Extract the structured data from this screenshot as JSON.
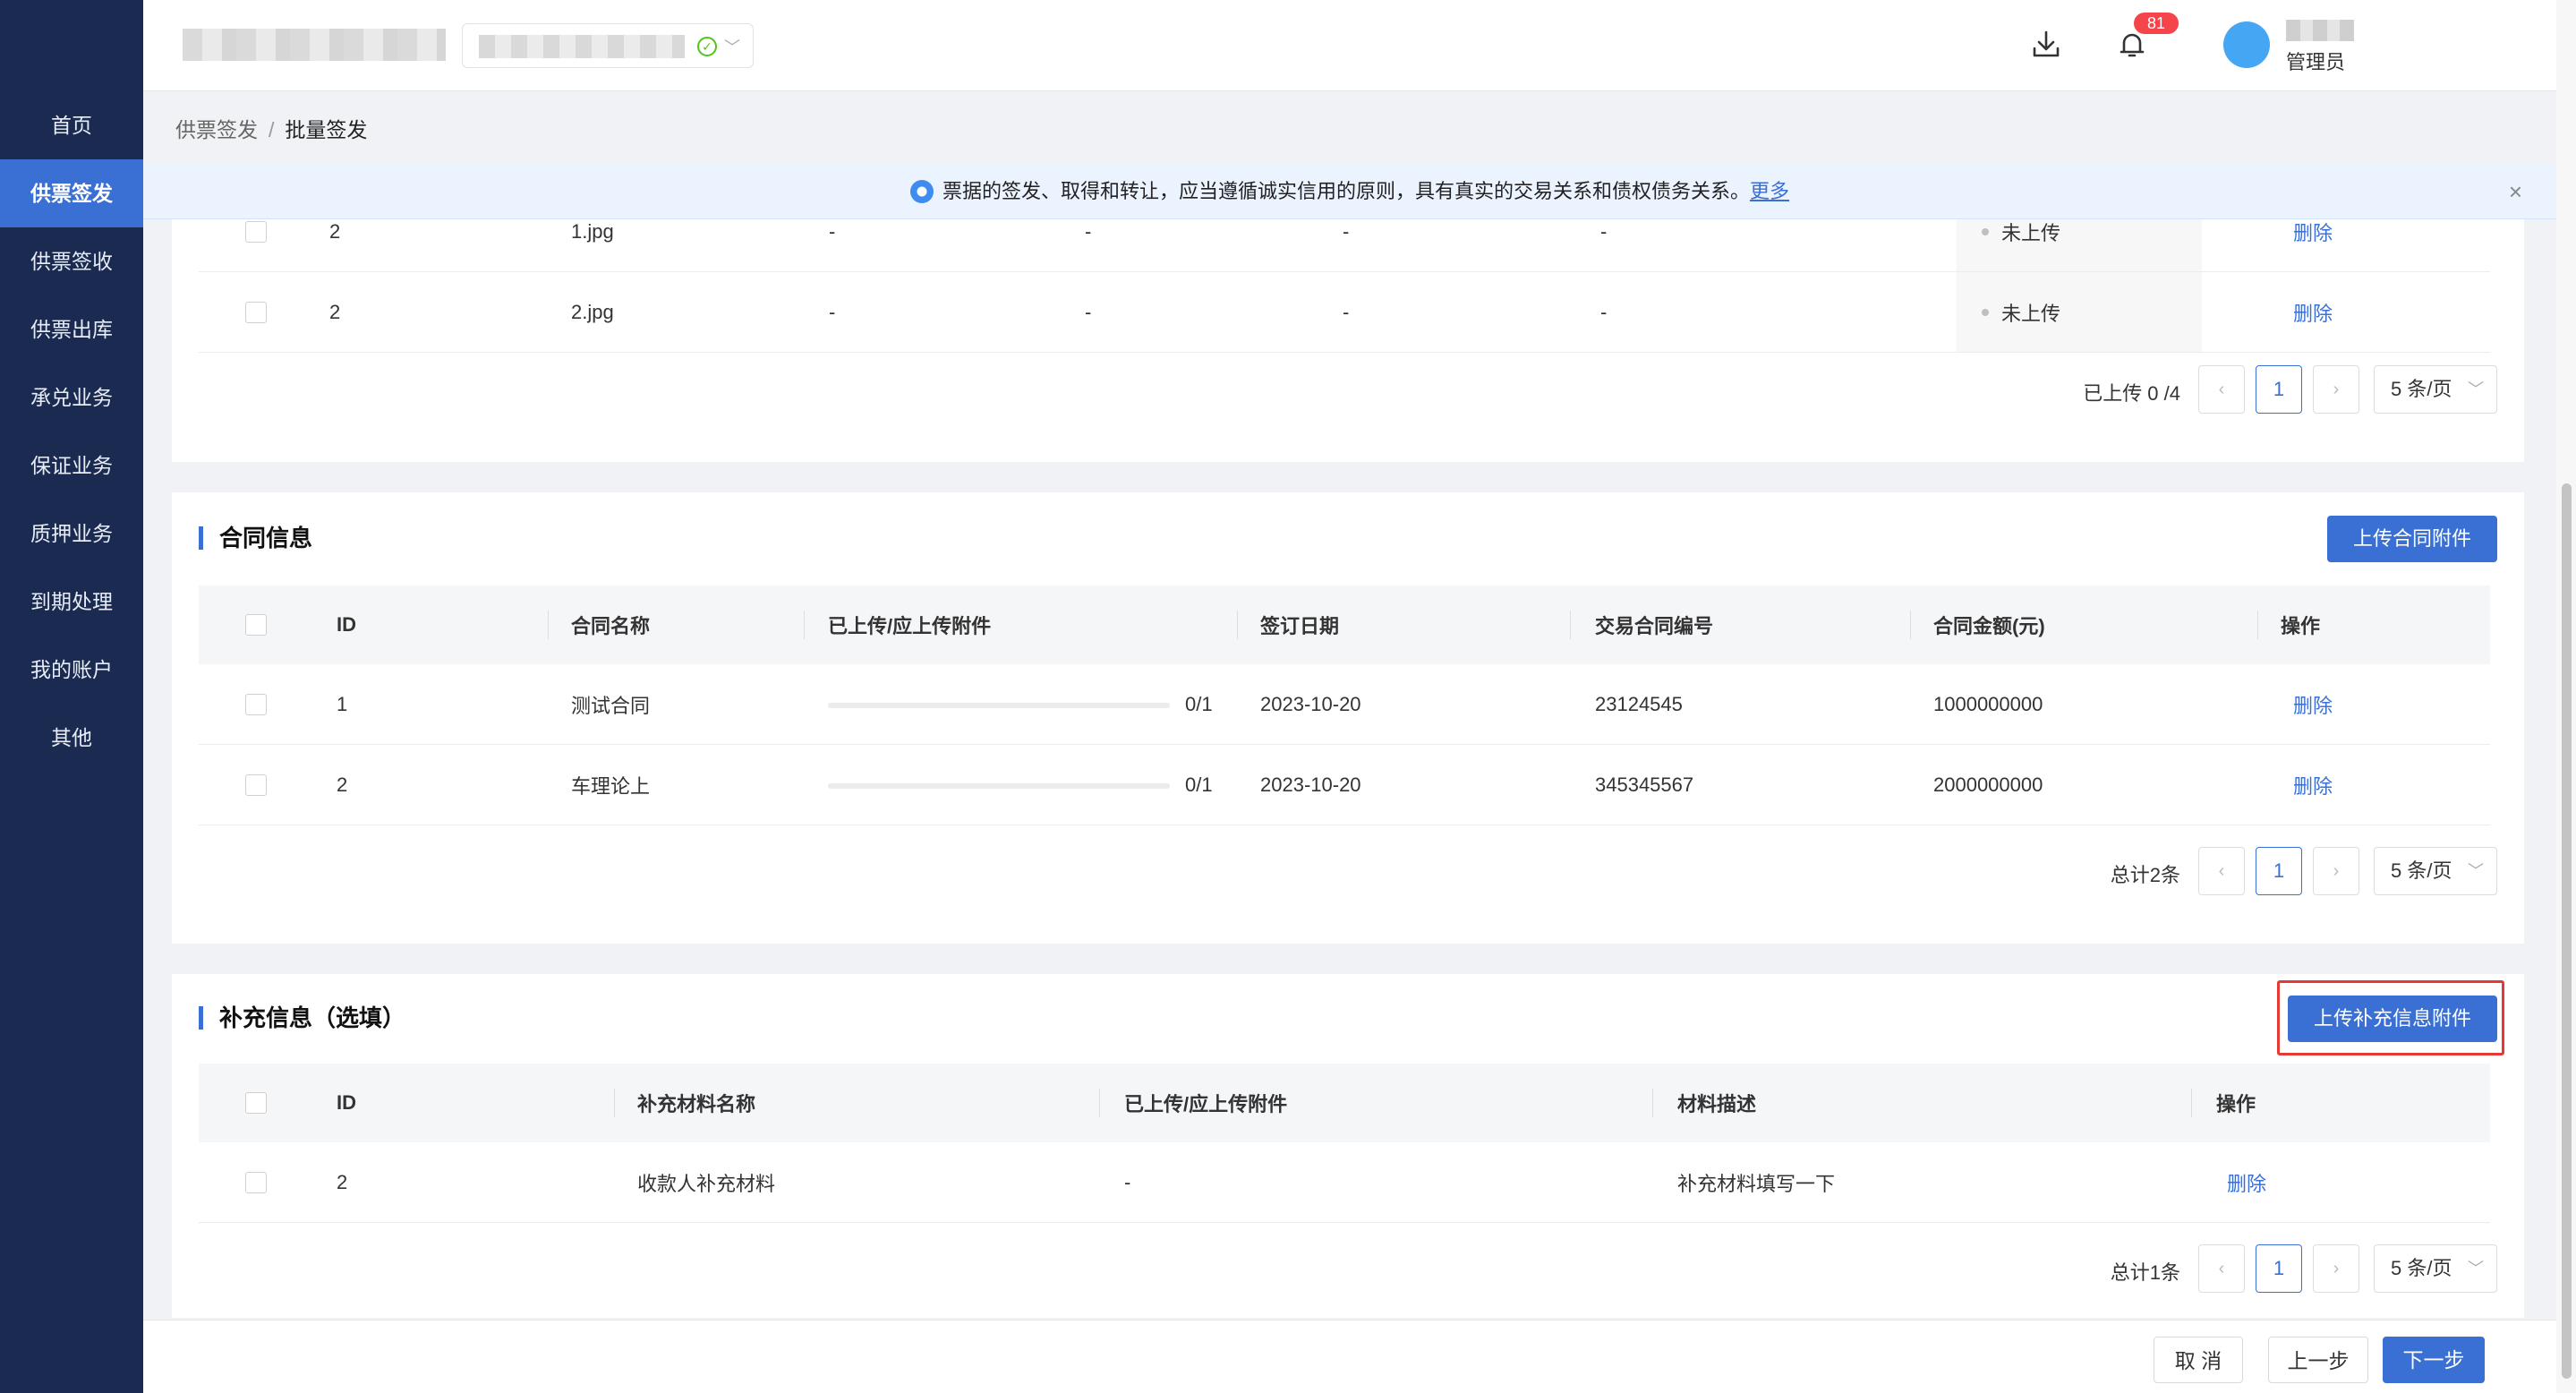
{
  "sidebar": {
    "items": [
      {
        "label": "首页"
      },
      {
        "label": "供票签发"
      },
      {
        "label": "供票签收"
      },
      {
        "label": "供票出库"
      },
      {
        "label": "承兑业务"
      },
      {
        "label": "保证业务"
      },
      {
        "label": "质押业务"
      },
      {
        "label": "到期处理"
      },
      {
        "label": "我的账户"
      },
      {
        "label": "其他"
      }
    ],
    "active_index": 1
  },
  "header": {
    "notification_count": "81",
    "user_role": "管理员",
    "ok_icon": "check-circle-icon",
    "dropdown_icon": "chevron-down-icon"
  },
  "breadcrumb": {
    "parent": "供票签发",
    "separator": "/",
    "current": "批量签发"
  },
  "notice": {
    "text": "票据的签发、取得和转让，应当遵循诚实信用的原则，具有真实的交易关系和债权债务关系。",
    "link": "更多",
    "close": "×"
  },
  "attachments_section": {
    "rows": [
      {
        "id": "2",
        "name": "1.jpg",
        "c1": "-",
        "c2": "-",
        "c3": "-",
        "c4": "-",
        "status": "未上传",
        "action": "删除"
      },
      {
        "id": "2",
        "name": "2.jpg",
        "c1": "-",
        "c2": "-",
        "c3": "-",
        "c4": "-",
        "status": "未上传",
        "action": "删除"
      }
    ],
    "pager": {
      "label": "已上传 0 /4",
      "current": "1",
      "size": "5 条/页"
    }
  },
  "contract_section": {
    "title": "合同信息",
    "upload_button": "上传合同附件",
    "columns": [
      "ID",
      "合同名称",
      "已上传/应上传附件",
      "签订日期",
      "交易合同编号",
      "合同金额(元)",
      "操作"
    ],
    "rows": [
      {
        "id": "1",
        "name": "测试合同",
        "progress": "0/1",
        "progress_value": 0,
        "date": "2023-10-20",
        "number": "23124545",
        "amount": "1000000000",
        "action": "删除"
      },
      {
        "id": "2",
        "name": "车理论上",
        "progress": "0/1",
        "progress_value": 0,
        "date": "2023-10-20",
        "number": "345345567",
        "amount": "2000000000",
        "action": "删除"
      }
    ],
    "pager": {
      "label": "总计2条",
      "current": "1",
      "size": "5 条/页"
    }
  },
  "supplement_section": {
    "title": "补充信息（选填）",
    "upload_button": "上传补充信息附件",
    "columns": [
      "ID",
      "补充材料名称",
      "已上传/应上传附件",
      "材料描述",
      "操作"
    ],
    "rows": [
      {
        "id": "2",
        "name": "收款人补充材料",
        "attach": "-",
        "desc": "补充材料填写一下",
        "action": "删除"
      }
    ],
    "pager": {
      "label": "总计1条",
      "current": "1",
      "size": "5 条/页"
    }
  },
  "footer": {
    "cancel": "取 消",
    "prev": "上一步",
    "next": "下一步"
  },
  "pager_icons": {
    "prev": "‹",
    "next": "›",
    "chevron": "﹀"
  },
  "colors": {
    "primary": "#3a6fd4",
    "sidebar": "#1a2a50",
    "badge": "#f5454a",
    "success": "#52c41a",
    "highlight": "#e53935"
  }
}
